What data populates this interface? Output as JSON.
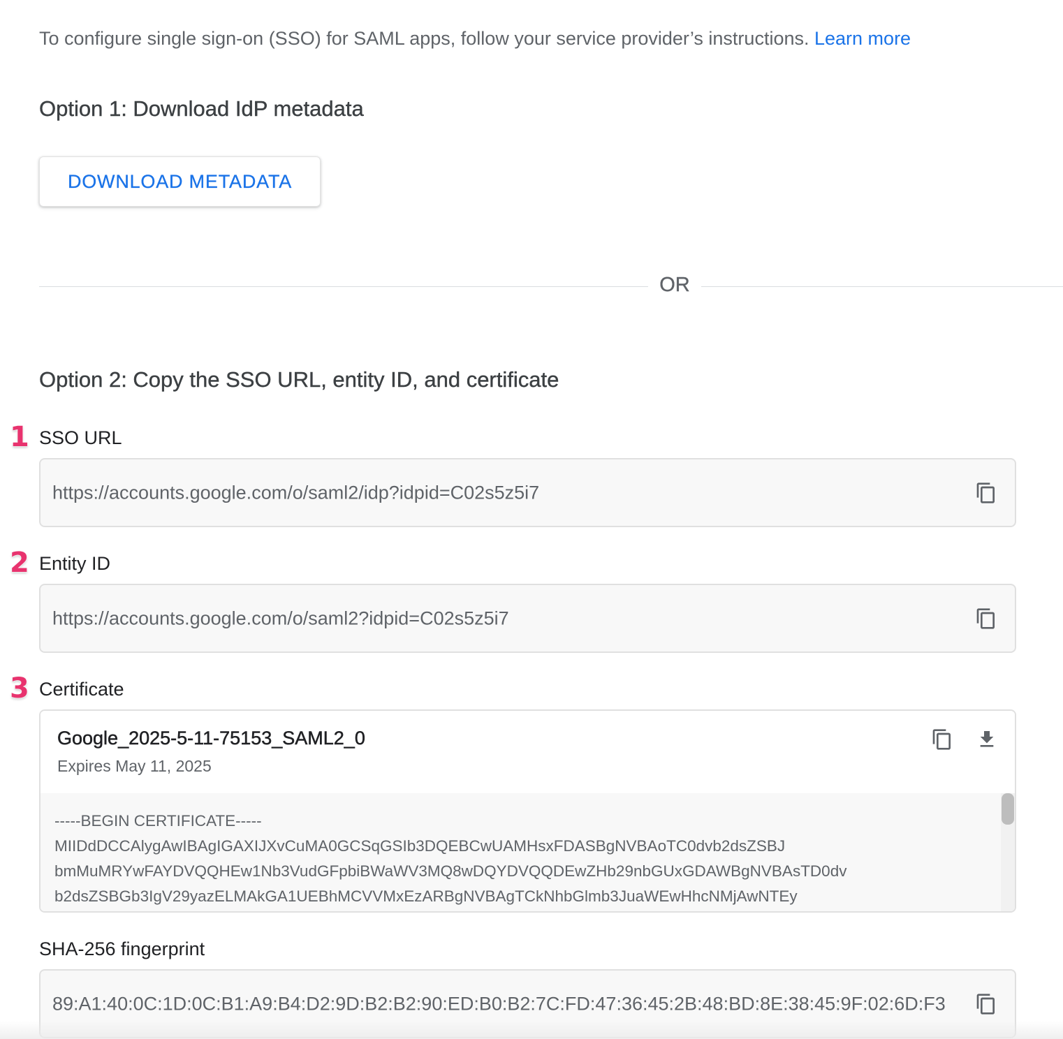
{
  "intro": {
    "text": "To configure single sign-on (SSO) for SAML apps, follow your service provider’s instructions.",
    "link_label": "Learn more"
  },
  "option1": {
    "heading": "Option 1: Download IdP metadata",
    "button_label": "DOWNLOAD METADATA"
  },
  "divider": {
    "label": "OR"
  },
  "option2": {
    "heading": "Option 2: Copy the SSO URL, entity ID, and certificate"
  },
  "annotations": [
    "1",
    "2",
    "3"
  ],
  "sso_url": {
    "label": "SSO URL",
    "value": "https://accounts.google.com/o/saml2/idp?idpid=C02s5z5i7"
  },
  "entity_id": {
    "label": "Entity ID",
    "value": "https://accounts.google.com/o/saml2?idpid=C02s5z5i7"
  },
  "certificate": {
    "label": "Certificate",
    "name": "Google_2025-5-11-75153_SAML2_0",
    "expires": "Expires May 11, 2025",
    "lines": [
      "-----BEGIN CERTIFICATE-----",
      "MIIDdDCCAlygAwIBAgIGAXIJXvCuMA0GCSqGSIb3DQEBCwUAMHsxFDASBgNVBAoTC0dvb2dsZSBJ",
      "bmMuMRYwFAYDVQQHEw1Nb3VudGFpbiBWaWV3MQ8wDQYDVQQDEwZHb29nbGUxGDAWBgNVBAsTD0dv",
      "b2dsZSBGb3IgV29yazELMAkGA1UEBhMCVVMxEzARBgNVBAgTCkNhbGlmb3JuaWEwHhcNMjAwNTEy"
    ]
  },
  "fingerprint": {
    "label": "SHA-256 fingerprint",
    "value": "89:A1:40:0C:1D:0C:B1:A9:B4:D2:9D:B2:B2:90:ED:B0:B2:7C:FD:47:36:45:2B:48:BD:8E:38:45:9F:02:6D:F3"
  },
  "icons": {
    "copy": "copy-icon",
    "download": "download-icon"
  },
  "colors": {
    "accent": "#1a73e8",
    "annotation": "#e8336e",
    "field_bg": "#f8f8f8",
    "border": "#e0e0e0"
  }
}
